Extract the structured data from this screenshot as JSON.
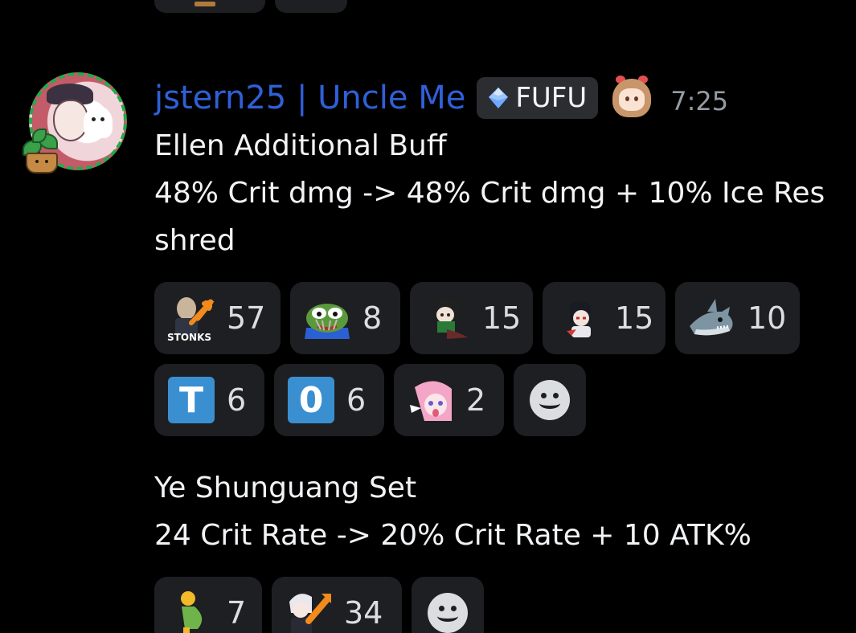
{
  "message": {
    "author": {
      "username": "jstern25 | Uncle Me",
      "tag_label": "FUFU",
      "timestamp": "7:25",
      "name_color": "#2f60d8"
    },
    "block1": {
      "line1": "Ellen Additional Buff",
      "line2": "48% Crit dmg -> 48% Crit dmg + 10% Ice Res",
      "line3": "shred"
    },
    "reactions1": [
      {
        "emoji": "stonks-icon",
        "label": "STONKS",
        "count": "57"
      },
      {
        "emoji": "pepe-frog-icon",
        "count": "8"
      },
      {
        "emoji": "anime-girl-icon",
        "count": "15"
      },
      {
        "emoji": "anime-boy-icon",
        "count": "15"
      },
      {
        "emoji": "shark-icon",
        "count": "10"
      },
      {
        "emoji": "letter-t-icon",
        "letter": "T",
        "count": "6"
      },
      {
        "emoji": "letter-o-icon",
        "letter": "0",
        "count": "6"
      },
      {
        "emoji": "pink-anime-icon",
        "count": "2"
      }
    ],
    "block2": {
      "line1": "Ye Shunguang Set",
      "line2": "24 Crit Rate -> 20% Crit Rate + 10 ATK%"
    },
    "reactions2": [
      {
        "emoji": "pregnant-man-icon",
        "count": "7"
      },
      {
        "emoji": "white-hair-stonks-icon",
        "count": "34"
      }
    ]
  },
  "colors": {
    "background": "#000000",
    "pill": "#1e1f22",
    "text": "#f2f3f5",
    "timestamp": "#949ba4",
    "tag_bg": "#2b2d31"
  }
}
